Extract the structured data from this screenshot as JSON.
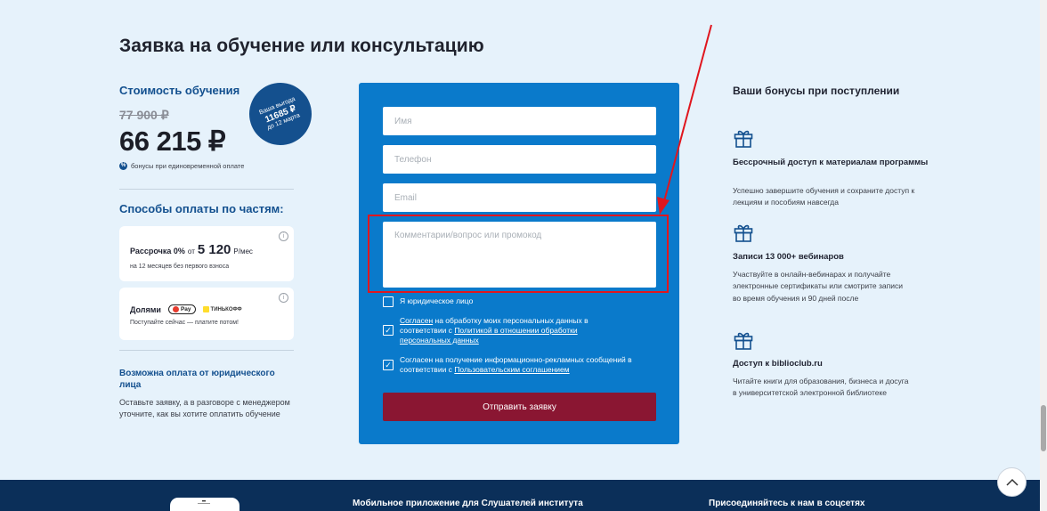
{
  "page": {
    "title": "Заявка на обучение или консультацию"
  },
  "pricing": {
    "heading": "Стоимость обучения",
    "old_price": "77 900 ₽",
    "new_price": "66 215 ₽",
    "discount_note": "бонусы при единовременной оплате",
    "badge": {
      "line1": "Ваша выгода",
      "amount": "11685 ₽",
      "line3": "до 12 марта"
    }
  },
  "installments": {
    "heading": "Способы оплаты по частям:",
    "card1": {
      "label": "Рассрочка 0%",
      "from": "от",
      "amount": "5 120",
      "per_month": "Р/мес",
      "sub": "на 12 месяцев без первого взноса"
    },
    "card2": {
      "label": "Долями",
      "logo1": "Pay",
      "logo2": "ТИНЬКОФФ",
      "sub": "Поступайте сейчас — платите потом!"
    }
  },
  "legal": {
    "heading": "Возможна оплата от юридического лица",
    "text": "Оставьте заявку, а в разговоре с менеджером уточните, как вы хотите оплатить обучение"
  },
  "form": {
    "name_placeholder": "Имя",
    "phone_placeholder": "Телефон",
    "email_placeholder": "Email",
    "comment_placeholder": "Комментарии/вопрос или промокод",
    "legal_entity_label": "Я юридическое лицо",
    "consent1": {
      "link1": "Согласен",
      "text1": " на обработку моих персональных данных в соответствии с ",
      "link2": "Политикой в отношении обработки персональных данных"
    },
    "consent2": {
      "text1": "Согласен на получение информационно-рекламных сообщений в соответствии с ",
      "link": "Пользовательским соглашением"
    },
    "submit_label": "Отправить заявку",
    "legal_entity_checked": false,
    "consent1_checked": true,
    "consent2_checked": true
  },
  "bonuses": {
    "heading": "Ваши бонусы при поступлении",
    "items": [
      {
        "title": "Бессрочный доступ к материалам программы",
        "text": "Успешно завершите обучения и сохраните доступ к лекциям и пособиям навсегда"
      },
      {
        "title": "Записи 13 000+ вебинаров",
        "text": "Участвуйте в онлайн-вебинарах и получайте электронные сертификаты или смотрите записи во время обучения и 90 дней после"
      },
      {
        "title": "Доступ к biblioclub.ru",
        "text": "Читайте книги для образования, бизнеса и досуга в университетской электронной библиотеке"
      }
    ]
  },
  "footer": {
    "app_text": "Мобильное приложение для Слушателей института",
    "social_text": "Присоединяйтесь к нам в соцсетях"
  },
  "colors": {
    "accent_blue": "#0a7acb",
    "brand_navy": "#13508f",
    "submit_red": "#8a1632",
    "highlight_red": "#e0161e",
    "background": "#e6f2fb",
    "footer_navy": "#0b2f59"
  }
}
